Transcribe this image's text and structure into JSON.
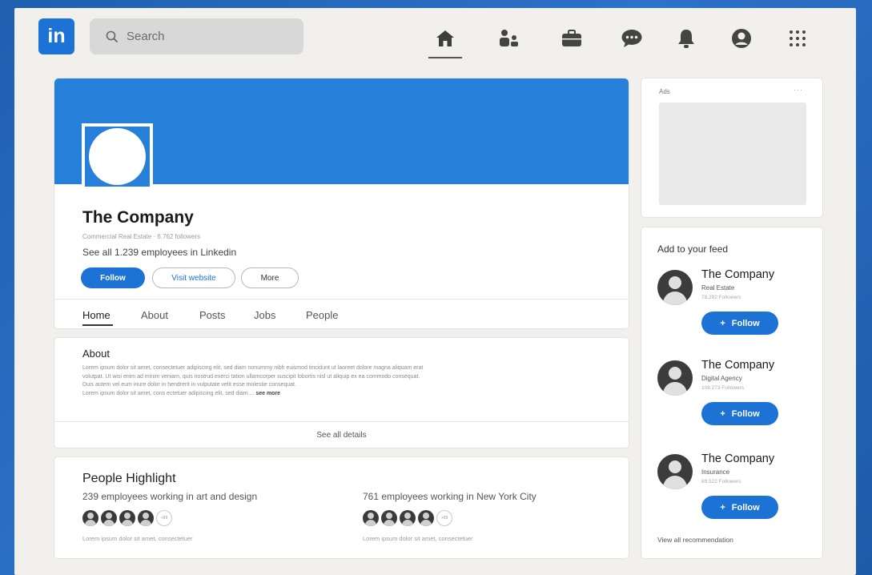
{
  "nav": {
    "logo_text": "in",
    "search_placeholder": "Search",
    "icons": [
      "home-icon",
      "network-icon",
      "jobs-icon",
      "messaging-icon",
      "notifications-icon",
      "profile-icon",
      "apps-grid-icon"
    ],
    "active_icon": "home-icon"
  },
  "colors": {
    "brand": "#1d72d6",
    "banner": "#2680d9",
    "background": "#f1f0ec"
  },
  "company": {
    "name": "The Company",
    "meta": "Commercial Real Estate · 6.762 followers",
    "employees": "See all 1.239 employees in Linkedin",
    "actions": {
      "follow": "Follow",
      "visit": "Visit website",
      "more": "More"
    },
    "tabs": [
      "Home",
      "About",
      "Posts",
      "Jobs",
      "People"
    ],
    "active_tab": "Home"
  },
  "about": {
    "title": "About",
    "lines": [
      "Lorem ipsum dolor sit amet, consectetuer adipiscing elit, sed diam nonummy nibh euismod tincidunt ut laoreet dolore magna aliquam erat",
      "volutpat. Ut wisi enim ad minim veniam, quis nostrud exerci tation ullamcorper suscipit lobortis nisl ut aliquip ex ea commodo consequat.",
      "Duis autem vel eum iriure dolor in hendrerit in vulputate velit esse molestie consequat.",
      "Lorem ipsum dolor sit amet, cons ectetuer adipiscing elit, sed diam...."
    ],
    "see_more": "see more",
    "see_all": "See all details"
  },
  "people_highlight": {
    "title": "People Highlight",
    "groups": [
      {
        "text": "239 employees working in art and design",
        "more": "+99",
        "note": "Lorem ipsum dolor sit amet, consectetuer"
      },
      {
        "text": "761 employees working in New York City",
        "more": "+99",
        "note": "Lorem ipsum dolor sit amet, consectetuer"
      }
    ]
  },
  "ads": {
    "label": "Ads",
    "menu": "···"
  },
  "feed": {
    "title": "Add to your feed",
    "items": [
      {
        "name": "The Company",
        "category": "Real Estate",
        "followers": "78.292 Followers",
        "button": "Follow"
      },
      {
        "name": "The Company",
        "category": "Digital Agency",
        "followers": "108.273 Followers",
        "button": "Follow"
      },
      {
        "name": "The Company",
        "category": "Insurance",
        "followers": "89.522 Followers",
        "button": "Follow"
      }
    ],
    "view_all": "View all recommendation"
  }
}
